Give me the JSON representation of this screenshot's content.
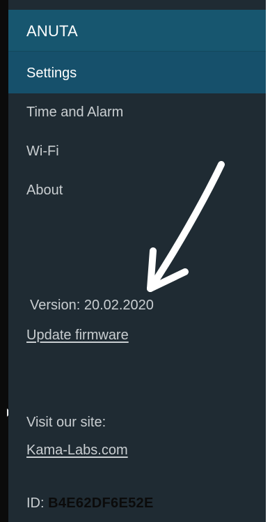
{
  "app": {
    "title": "ANUTA"
  },
  "nav": {
    "active_label": "Settings",
    "items": [
      {
        "label": "Time and Alarm"
      },
      {
        "label": "Wi-Fi"
      },
      {
        "label": "About"
      }
    ]
  },
  "about": {
    "version_text": "Version: 20.02.2020",
    "update_link": "Update firmware",
    "visit_text": "Visit our site:",
    "site_link": "Kama-Labs.com",
    "id_prefix": "ID:",
    "id_value": "B4E62DF6E52E"
  },
  "colors": {
    "sidebar_bg": "#1f2b33",
    "header_bg": "#17566f",
    "active_bg": "#16506b",
    "text": "#c9ced1",
    "annotation_arrow": "#ffffff"
  },
  "icons": {
    "annotation": "arrow-annotation-icon"
  }
}
